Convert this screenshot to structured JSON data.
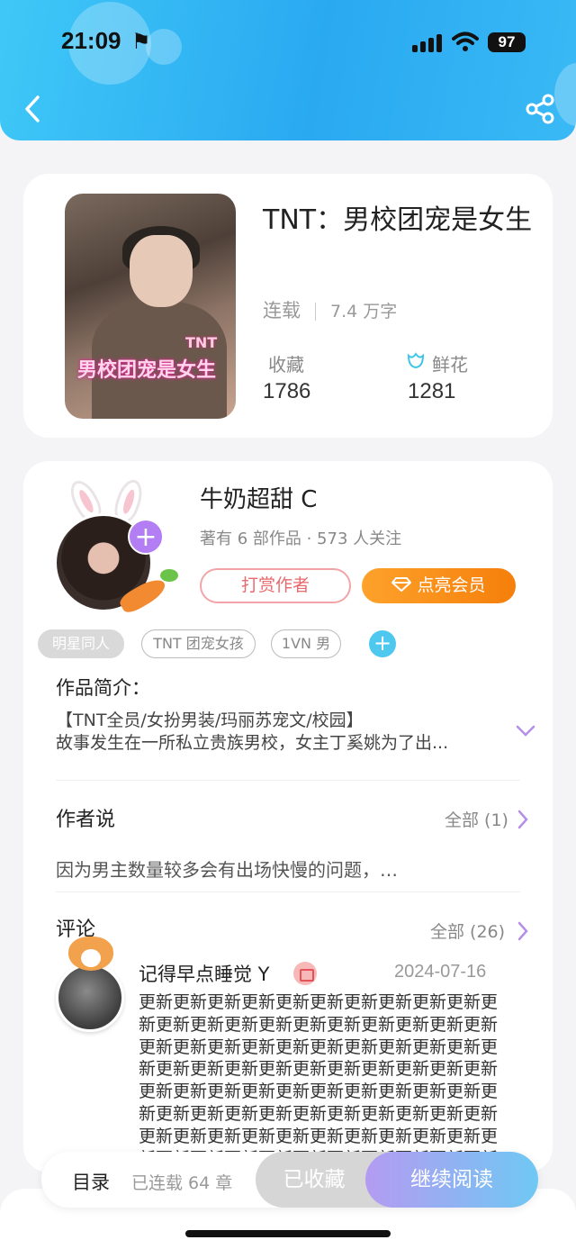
{
  "status_bar": {
    "time": "21:09",
    "battery": "97"
  },
  "header": {
    "back_icon": "chevron-left-icon",
    "share_icon": "share-icon"
  },
  "book": {
    "title": "TNT：男校团宠是女生",
    "status": "连载",
    "word_count": "7.4 万字",
    "favorites_label": "收藏",
    "favorites_value": "1786",
    "flowers_label": "鲜花",
    "flowers_value": "1281",
    "cover_text": "男校团宠是女生",
    "cover_badge": "TNT"
  },
  "author": {
    "name": "牛奶超甜 C",
    "stats": "著有 6 部作品 · 573 人关注",
    "reward_label": "打赏作者",
    "vip_label": "点亮会员",
    "tags": [
      "明星同人",
      "TNT 团宠女孩",
      "1VN 男"
    ]
  },
  "intro": {
    "heading": "作品简介：",
    "line1": "【TNT全员/女扮男装/玛丽苏宠文/校园】",
    "line2": "故事发生在一所私立贵族男校，女主丁奚姚为了出..."
  },
  "author_says": {
    "heading": "作者说",
    "all_label": "全部 (1)",
    "text": "因为男主数量较多会有出场快慢的问题，…"
  },
  "comments": {
    "heading": "评论",
    "all_label": "全部 (26)",
    "items": [
      {
        "user": "记得早点睡觉 Y",
        "date": "2024-07-16",
        "text": "更新更新更新更新更新更新更新更新更新更新更新更新更新更新更新更新更新更新更新更新更新更新更新更新更新更新更新更新更新更新更新更新更新更新更新更新更新更新更新更新更新更新更新更新更新更新更新更新更新更新更新更新更新更新更新更新更新更新更新更新更新更新更新更新更新更新更新更新更新更新更新更新更新更新更新更新更新更新更新更新更新更新更新更新更新更新"
      }
    ]
  },
  "bottom_bar": {
    "toc_label": "目录",
    "chapters_label": "已连载 64 章",
    "collected_label": "已收藏",
    "read_label": "继续阅读"
  },
  "colors": {
    "header_blue": "#2aa9f1",
    "vip_orange": "#f57f0b",
    "reward_pink": "#e8696e",
    "read_gradient_start": "#b49bf2"
  }
}
